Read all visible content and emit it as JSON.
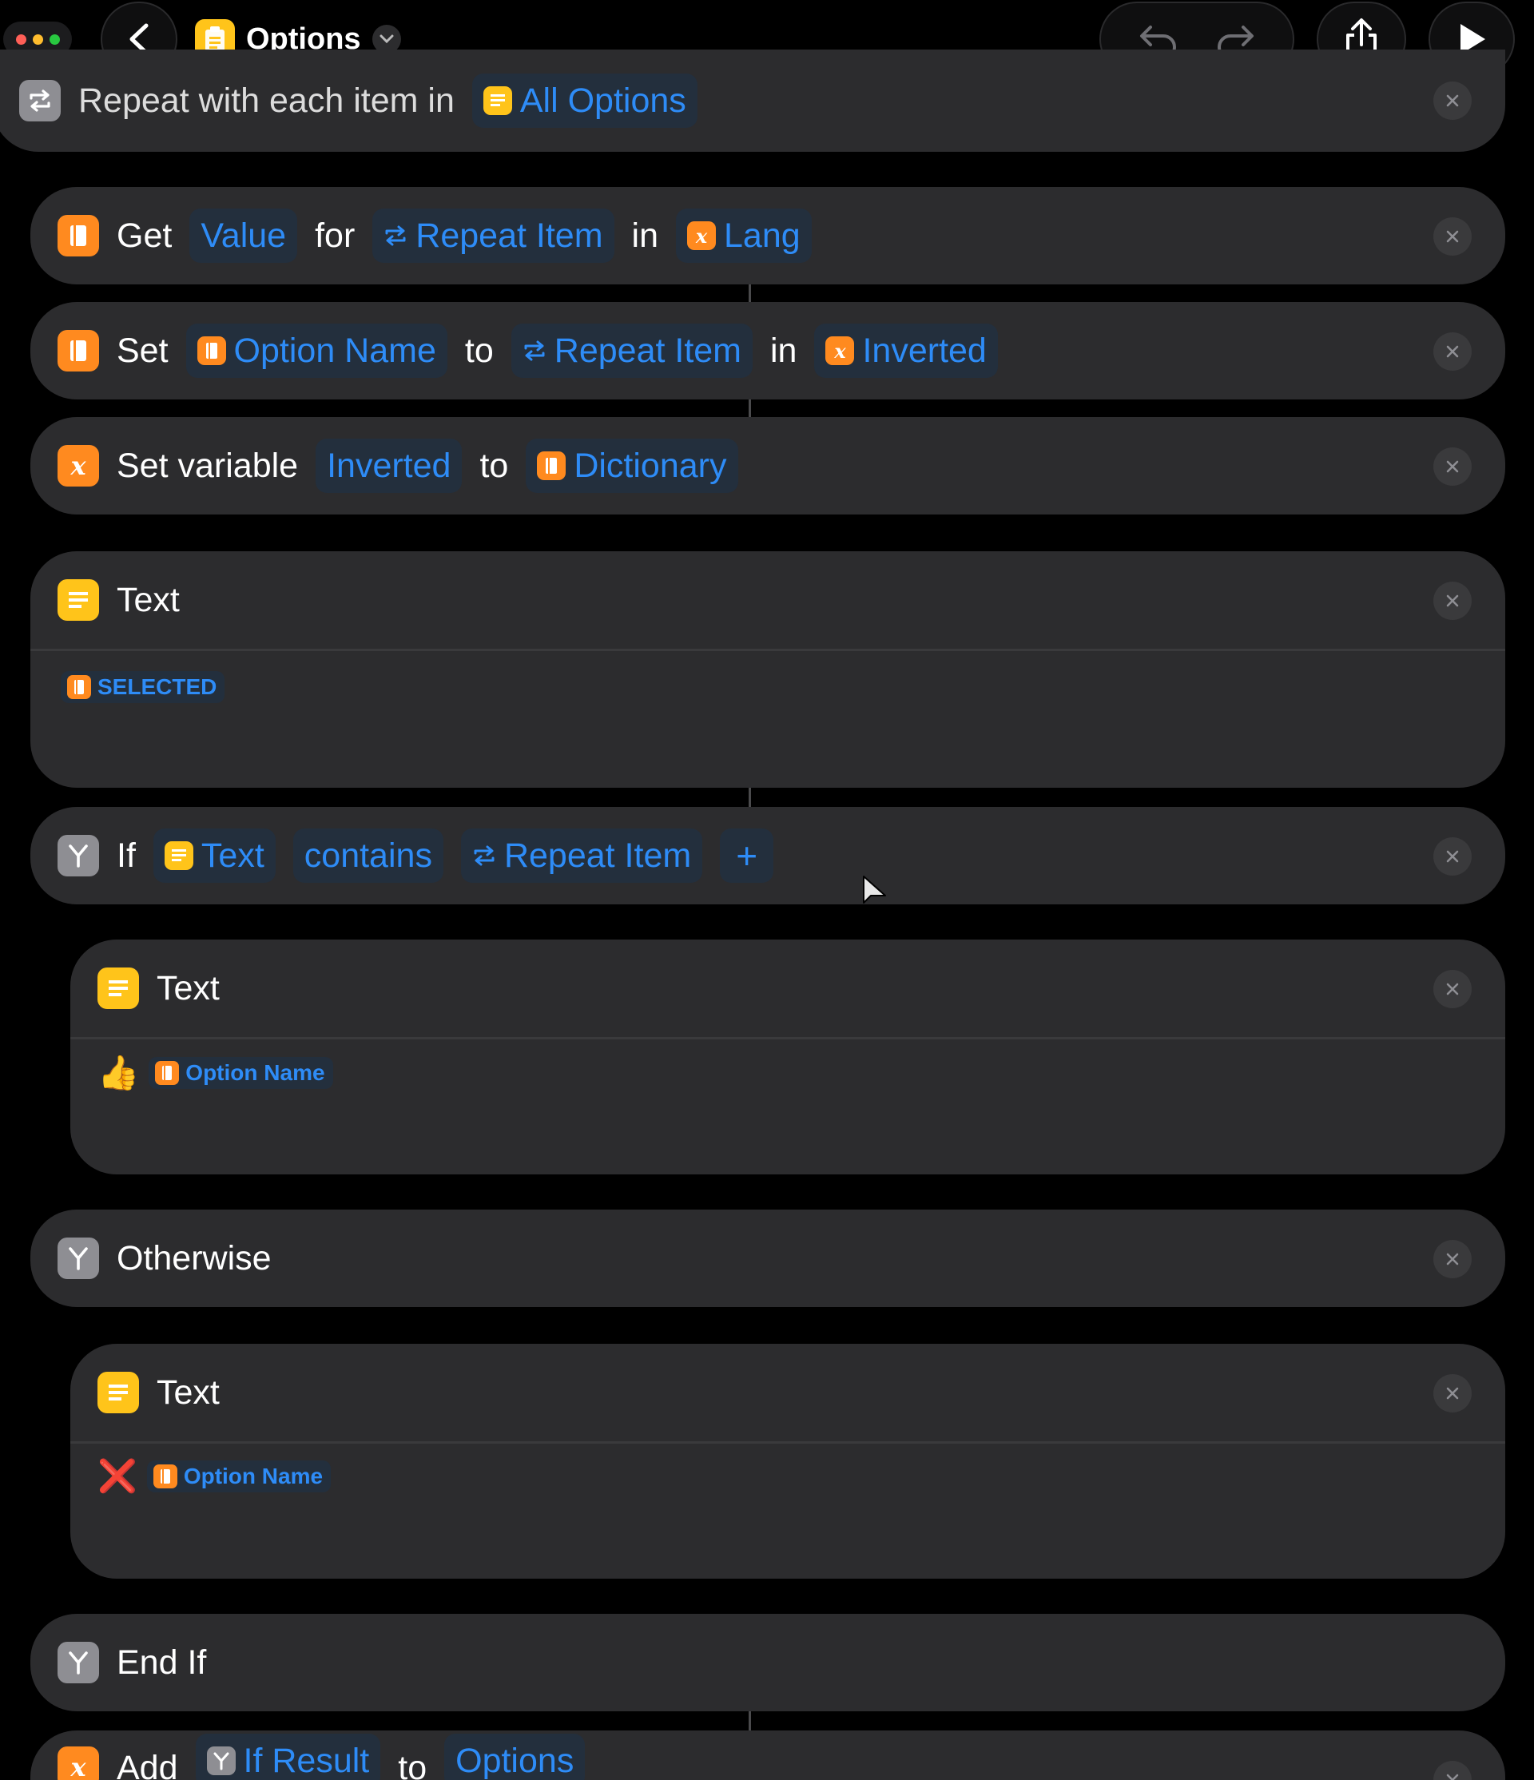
{
  "window": {
    "title": "Options"
  },
  "repeat": {
    "label": "Repeat with each item in",
    "source": "All Options"
  },
  "get_action": {
    "verb": "Get",
    "field": "Value",
    "for_word": "for",
    "key": "Repeat Item",
    "in_word": "in",
    "dict": "Lang"
  },
  "set_action": {
    "verb": "Set",
    "key": "Option Name",
    "to_word": "to",
    "value": "Repeat Item",
    "in_word": "in",
    "dict": "Inverted"
  },
  "set_variable": {
    "label": "Set variable",
    "variable": "Inverted",
    "to_word": "to",
    "value": "Dictionary"
  },
  "text_selected": {
    "title": "Text",
    "token": "SELECTED"
  },
  "if_action": {
    "keyword": "If",
    "input": "Text",
    "condition": "contains",
    "value": "Repeat Item",
    "add": "+"
  },
  "text_thumb": {
    "title": "Text",
    "emoji": "👍",
    "token": "Option Name"
  },
  "otherwise": {
    "label": "Otherwise"
  },
  "text_cross": {
    "title": "Text",
    "emoji": "❌",
    "token": "Option Name"
  },
  "end_if": {
    "label": "End If"
  },
  "add_action": {
    "verb": "Add",
    "value": "If Result",
    "to_word": "to",
    "target": "Options"
  },
  "colors": {
    "accent_blue": "#2e8cf7",
    "card_bg": "#2c2c2e",
    "orange": "#ff8a1f",
    "yellow": "#ffc41a",
    "grey": "#8e8e93"
  }
}
